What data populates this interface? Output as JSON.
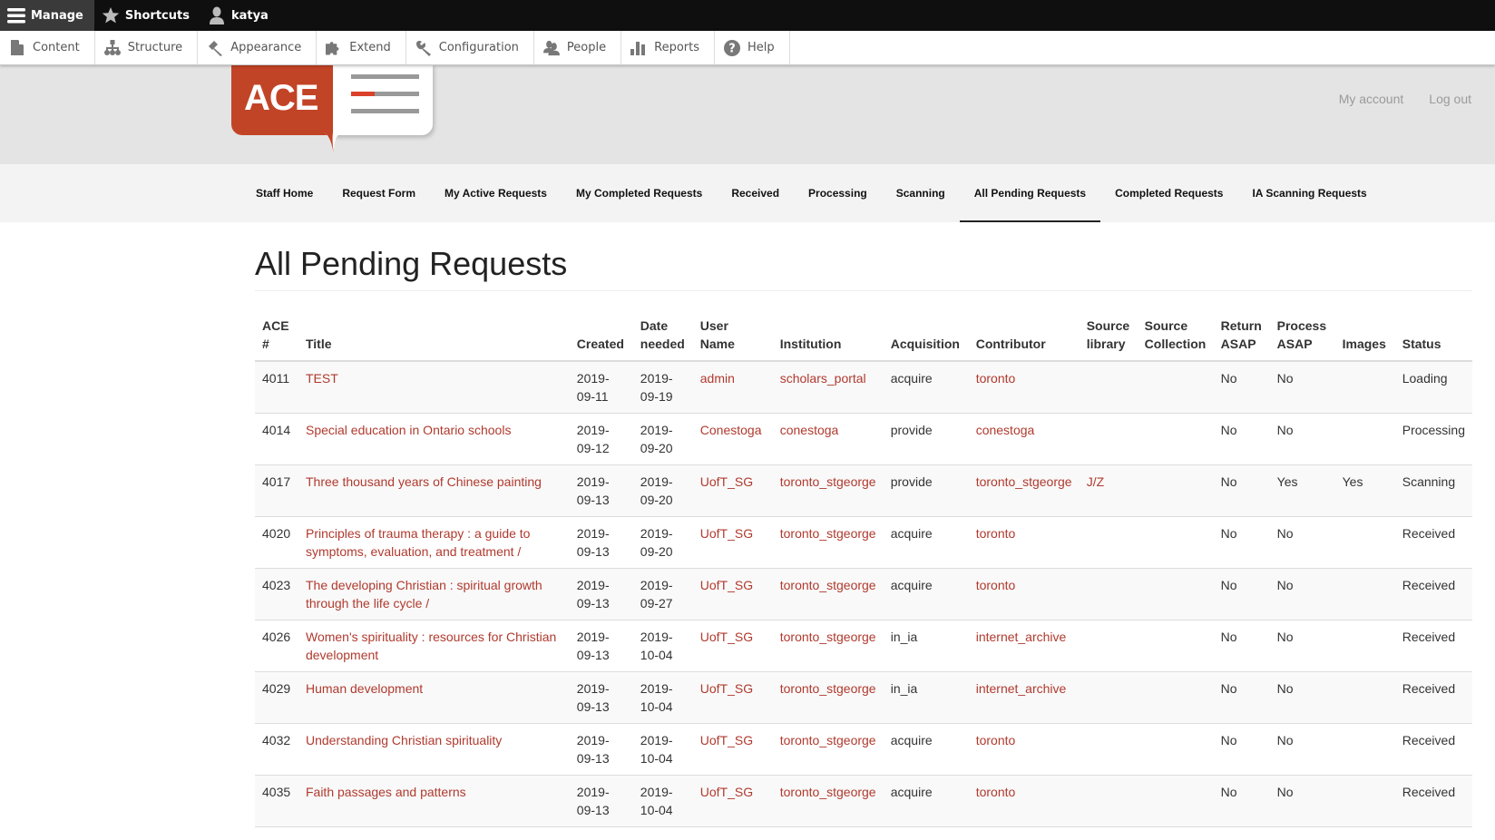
{
  "toolbar": {
    "manage": "Manage",
    "shortcuts": "Shortcuts",
    "user": "katya"
  },
  "tray": [
    {
      "label": "Content",
      "icon": "file-icon"
    },
    {
      "label": "Structure",
      "icon": "sitemap-icon"
    },
    {
      "label": "Appearance",
      "icon": "paintbrush-icon"
    },
    {
      "label": "Extend",
      "icon": "puzzle-icon"
    },
    {
      "label": "Configuration",
      "icon": "wrench-icon"
    },
    {
      "label": "People",
      "icon": "people-icon"
    },
    {
      "label": "Reports",
      "icon": "bar-chart-icon"
    },
    {
      "label": "Help",
      "icon": "help-icon"
    }
  ],
  "header": {
    "logo_text": "ACE",
    "links": [
      "My account",
      "Log out"
    ]
  },
  "nav": {
    "items": [
      "Staff Home",
      "Request Form",
      "My Active Requests",
      "My Completed Requests",
      "Received",
      "Processing",
      "Scanning",
      "All Pending Requests",
      "Completed Requests",
      "IA Scanning Requests"
    ],
    "active": "All Pending Requests"
  },
  "page": {
    "title": "All Pending Requests"
  },
  "table": {
    "headers": {
      "num_1": "ACE",
      "num_2": "#",
      "title": "Title",
      "created": "Created",
      "needed_1": "Date",
      "needed_2": "needed",
      "user_1": "User",
      "user_2": "Name",
      "institution": "Institution",
      "acquisition": "Acquisition",
      "contributor": "Contributor",
      "srclib_1": "Source",
      "srclib_2": "library",
      "srccol_1": "Source",
      "srccol_2": "Collection",
      "ret_1": "Return",
      "ret_2": "ASAP",
      "proc_1": "Process",
      "proc_2": "ASAP",
      "images": "Images",
      "status": "Status"
    },
    "rows": [
      {
        "num": "4011",
        "title": "TEST",
        "created_1": "2019-",
        "created_2": "09-11",
        "needed_1": "2019-",
        "needed_2": "09-19",
        "user": "admin",
        "institution": "scholars_portal",
        "acquisition": "acquire",
        "contributor": "toronto",
        "source_library": "",
        "source_collection": "",
        "return_asap": "No",
        "process_asap": "No",
        "images": "",
        "status": "Loading"
      },
      {
        "num": "4014",
        "title": "Special education in Ontario schools",
        "created_1": "2019-",
        "created_2": "09-12",
        "needed_1": "2019-",
        "needed_2": "09-20",
        "user": "Conestoga",
        "institution": "conestoga",
        "acquisition": "provide",
        "contributor": "conestoga",
        "source_library": "",
        "source_collection": "",
        "return_asap": "No",
        "process_asap": "No",
        "images": "",
        "status": "Processing"
      },
      {
        "num": "4017",
        "title": "Three thousand years of Chinese painting",
        "created_1": "2019-",
        "created_2": "09-13",
        "needed_1": "2019-",
        "needed_2": "09-20",
        "user": "UofT_SG",
        "institution": "toronto_stgeorge",
        "acquisition": "provide",
        "contributor": "toronto_stgeorge",
        "source_library": "J/Z",
        "source_collection": "",
        "return_asap": "No",
        "process_asap": "Yes",
        "images": "Yes",
        "status": "Scanning"
      },
      {
        "num": "4020",
        "title": "Principles of trauma therapy : a guide to symptoms, evaluation, and treatment /",
        "created_1": "2019-",
        "created_2": "09-13",
        "needed_1": "2019-",
        "needed_2": "09-20",
        "user": "UofT_SG",
        "institution": "toronto_stgeorge",
        "acquisition": "acquire",
        "contributor": "toronto",
        "source_library": "",
        "source_collection": "",
        "return_asap": "No",
        "process_asap": "No",
        "images": "",
        "status": "Received"
      },
      {
        "num": "4023",
        "title": "The developing Christian : spiritual growth through the life cycle /",
        "created_1": "2019-",
        "created_2": "09-13",
        "needed_1": "2019-",
        "needed_2": "09-27",
        "user": "UofT_SG",
        "institution": "toronto_stgeorge",
        "acquisition": "acquire",
        "contributor": "toronto",
        "source_library": "",
        "source_collection": "",
        "return_asap": "No",
        "process_asap": "No",
        "images": "",
        "status": "Received"
      },
      {
        "num": "4026",
        "title": "Women's spirituality : resources for Christian development",
        "created_1": "2019-",
        "created_2": "09-13",
        "needed_1": "2019-",
        "needed_2": "10-04",
        "user": "UofT_SG",
        "institution": "toronto_stgeorge",
        "acquisition": "in_ia",
        "contributor": "internet_archive",
        "source_library": "",
        "source_collection": "",
        "return_asap": "No",
        "process_asap": "No",
        "images": "",
        "status": "Received"
      },
      {
        "num": "4029",
        "title": "Human development",
        "created_1": "2019-",
        "created_2": "09-13",
        "needed_1": "2019-",
        "needed_2": "10-04",
        "user": "UofT_SG",
        "institution": "toronto_stgeorge",
        "acquisition": "in_ia",
        "contributor": "internet_archive",
        "source_library": "",
        "source_collection": "",
        "return_asap": "No",
        "process_asap": "No",
        "images": "",
        "status": "Received"
      },
      {
        "num": "4032",
        "title": "Understanding Christian spirituality",
        "created_1": "2019-",
        "created_2": "09-13",
        "needed_1": "2019-",
        "needed_2": "10-04",
        "user": "UofT_SG",
        "institution": "toronto_stgeorge",
        "acquisition": "acquire",
        "contributor": "toronto",
        "source_library": "",
        "source_collection": "",
        "return_asap": "No",
        "process_asap": "No",
        "images": "",
        "status": "Received"
      },
      {
        "num": "4035",
        "title": "Faith passages and patterns",
        "created_1": "2019-",
        "created_2": "09-13",
        "needed_1": "2019-",
        "needed_2": "10-04",
        "user": "UofT_SG",
        "institution": "toronto_stgeorge",
        "acquisition": "acquire",
        "contributor": "toronto",
        "source_library": "",
        "source_collection": "",
        "return_asap": "No",
        "process_asap": "No",
        "images": "",
        "status": "Received"
      }
    ]
  }
}
